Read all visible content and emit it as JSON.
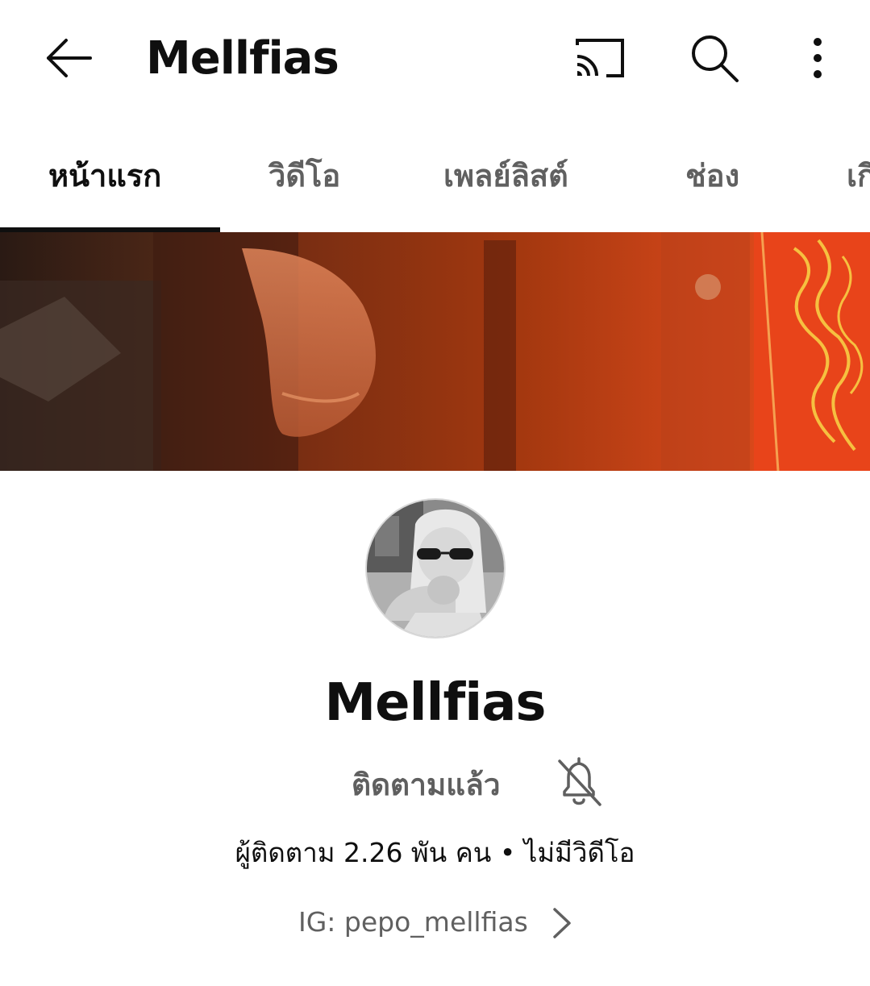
{
  "appbar": {
    "title": "Mellfias",
    "icons": [
      "back-arrow-icon",
      "cast-icon",
      "search-icon",
      "more-vert-icon"
    ]
  },
  "tabs": [
    {
      "label": "หน้าแรก",
      "active": true
    },
    {
      "label": "วิดีโอ",
      "active": false
    },
    {
      "label": "เพลย์ลิสต์",
      "active": false
    },
    {
      "label": "ช่อง",
      "active": false
    },
    {
      "label": "เกี่ยวกับ",
      "active": false
    }
  ],
  "channel": {
    "name": "Mellfias",
    "subscribe_label": "ติดตามแล้ว",
    "stats": "ผู้ติดตาม 2.26 พัน คน • ไม่มีวิดีโอ",
    "link_label": "IG: pepo_mellfias"
  },
  "colors": {
    "text_primary": "#0f0f0f",
    "text_secondary": "#606060",
    "banner_accent": "#e8501a"
  }
}
